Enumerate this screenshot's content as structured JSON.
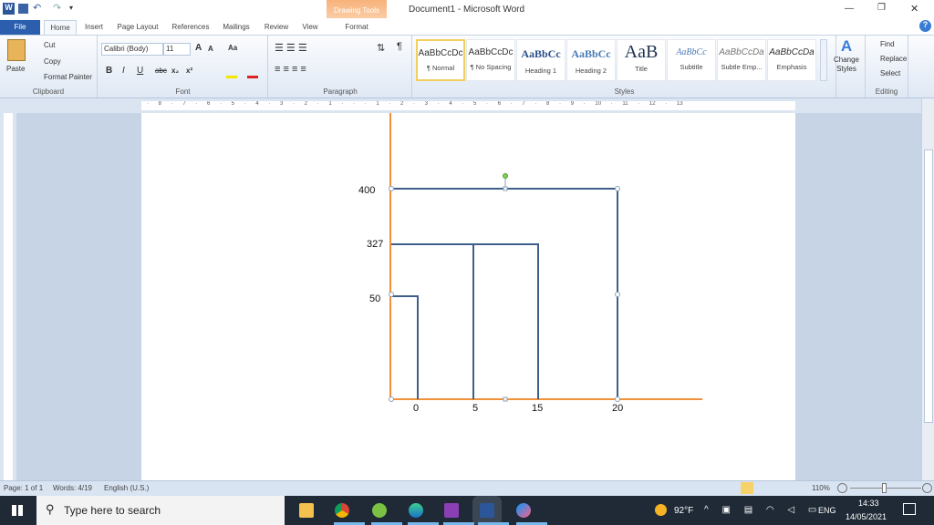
{
  "window": {
    "title": "Document1 - Microsoft Word",
    "contextual_tab_group": "Drawing Tools",
    "controls": {
      "minimize": "—",
      "restore": "❐",
      "close": "✕"
    }
  },
  "tabs": [
    {
      "label": "File"
    },
    {
      "label": "Home"
    },
    {
      "label": "Insert"
    },
    {
      "label": "Page Layout"
    },
    {
      "label": "References"
    },
    {
      "label": "Mailings"
    },
    {
      "label": "Review"
    },
    {
      "label": "View"
    },
    {
      "label": "Format"
    }
  ],
  "ribbon": {
    "clipboard": {
      "label": "Clipboard",
      "paste": "Paste",
      "cut": "Cut",
      "copy": "Copy",
      "format_painter": "Format Painter"
    },
    "font": {
      "label": "Font",
      "family": "Calibri (Body)",
      "size": "11",
      "bold": "B",
      "italic": "I",
      "underline": "U",
      "strike": "abc",
      "sub": "x₂",
      "sup": "x²",
      "grow": "A",
      "shrink": "A",
      "case": "Aa"
    },
    "paragraph": {
      "label": "Paragraph"
    },
    "styles": {
      "label": "Styles",
      "items": [
        {
          "preview": "AaBbCcDc",
          "name": "¶ Normal"
        },
        {
          "preview": "AaBbCcDc",
          "name": "¶ No Spacing"
        },
        {
          "preview": "AaBbCc",
          "name": "Heading 1"
        },
        {
          "preview": "AaBbCc",
          "name": "Heading 2"
        },
        {
          "preview": "AaB",
          "name": "Title"
        },
        {
          "preview": "AaBbCc",
          "name": "Subtitle"
        },
        {
          "preview": "AaBbCcDa",
          "name": "Subtle Emp..."
        },
        {
          "preview": "AaBbCcDa",
          "name": "Emphasis"
        }
      ],
      "change_styles": "Change Styles"
    },
    "editing": {
      "label": "Editing",
      "find": "Find",
      "replace": "Replace",
      "select": "Select"
    }
  },
  "ruler": {
    "marks": "· 8 · 7 · 6 · 5 · 4 · 3 · 2 · 1 · · · 1 · 2 · 3 · 4 · 5 · 6 · 7 · 8 · 9 · 10 · 11 · 12 · 13"
  },
  "drawing": {
    "y_labels": [
      "400",
      "327",
      "50"
    ],
    "x_labels": [
      "0",
      "5",
      "15",
      "20"
    ],
    "axis_color": "#f0913a",
    "line_color": "#3e5f8a"
  },
  "status": {
    "page": "Page: 1 of 1",
    "words": "Words: 4/19",
    "language": "English (U.S.)",
    "zoom": "110%"
  },
  "taskbar": {
    "search_placeholder": "Type here to search",
    "weather": "92°F",
    "lang": "ENG",
    "time": "14:33",
    "date": "14/05/2021"
  }
}
